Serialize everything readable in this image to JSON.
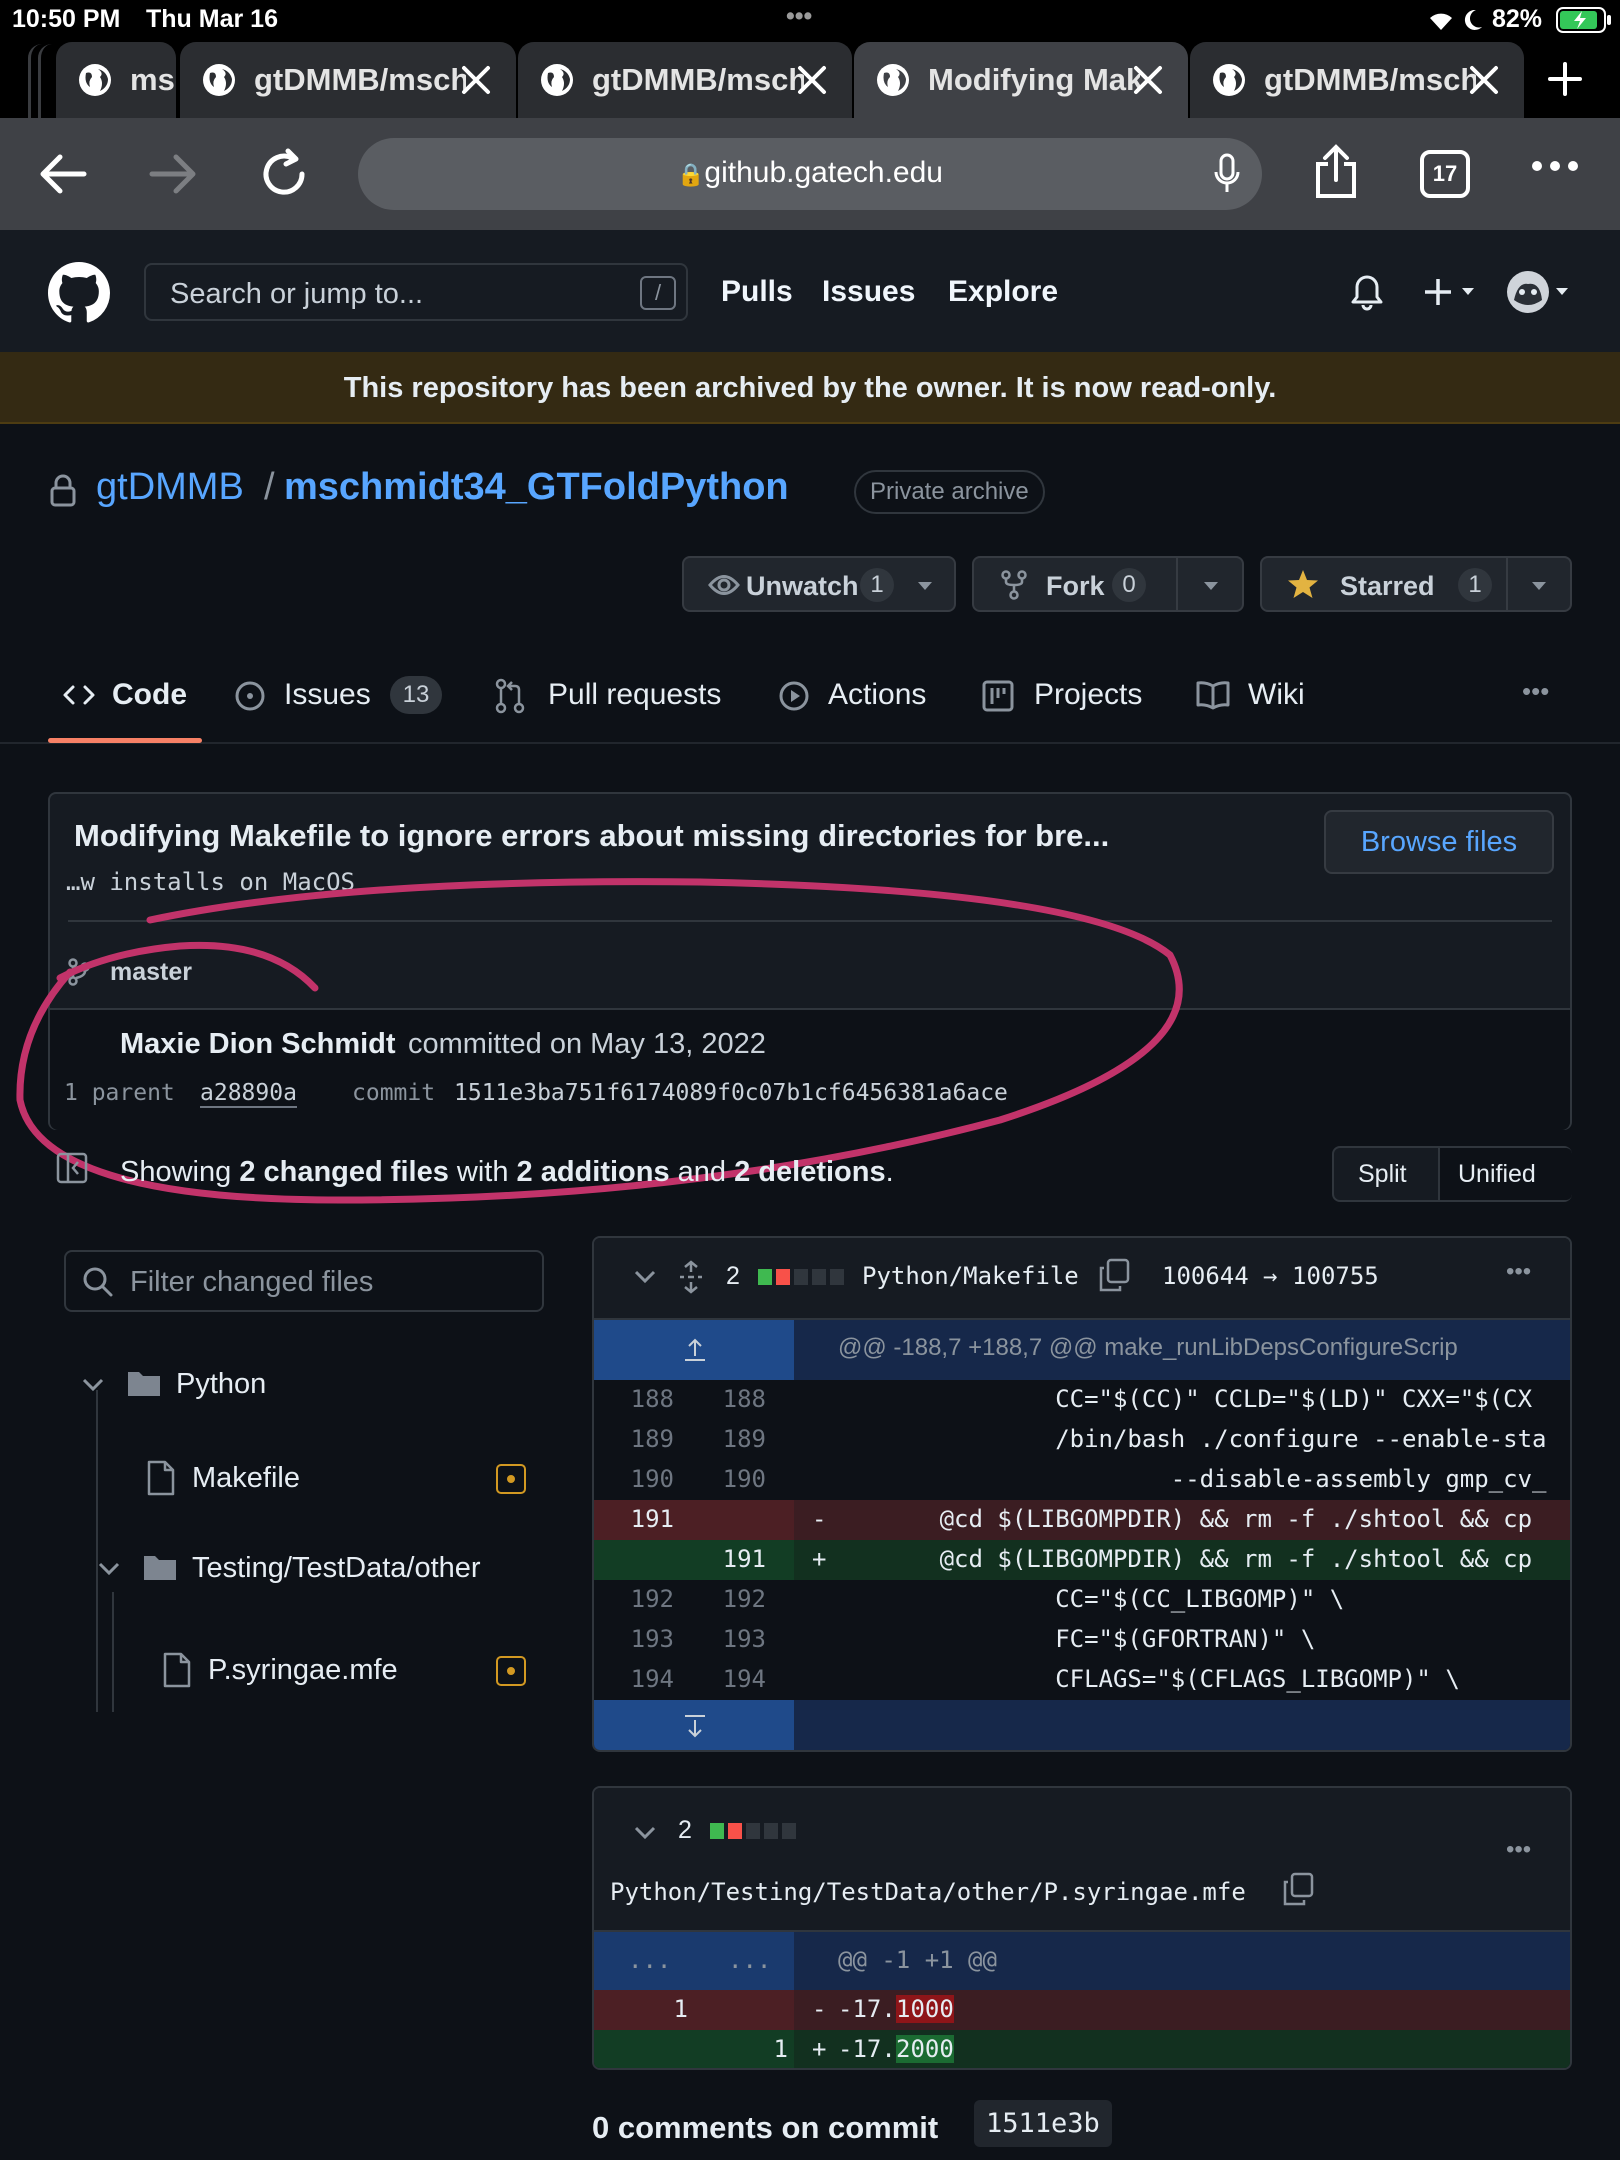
{
  "status_bar": {
    "time": "10:50 PM",
    "date": "Thu Mar 16",
    "dots": "•••",
    "battery": "82%"
  },
  "browser": {
    "tabs": [
      {
        "label": "msc"
      },
      {
        "label": "gtDMMB/msch"
      },
      {
        "label": "gtDMMB/msch"
      },
      {
        "label": "Modifying Mak"
      },
      {
        "label": "gtDMMB/msch"
      }
    ],
    "url": "github.gatech.edu",
    "tab_count": "17"
  },
  "github_header": {
    "search_placeholder": "Search or jump to...",
    "search_shortcut": "/",
    "nav": {
      "pulls": "Pulls",
      "issues": "Issues",
      "explore": "Explore"
    }
  },
  "archive_banner": "This repository has been archived by the owner. It is now read-only.",
  "repo": {
    "owner": "gtDMMB",
    "separator": "/",
    "name": "mschmidt34_GTFoldPython",
    "visibility": "Private archive",
    "unwatch_label": "Unwatch",
    "watch_count": "1",
    "fork_label": "Fork",
    "fork_count": "0",
    "starred_label": "Starred",
    "star_count": "1"
  },
  "repo_tabs": {
    "code": "Code",
    "issues": "Issues",
    "issues_count": "13",
    "pull_requests": "Pull requests",
    "actions": "Actions",
    "projects": "Projects",
    "wiki": "Wiki",
    "more": "•••"
  },
  "commit": {
    "title": "Modifying Makefile to ignore errors about missing directories for bre...",
    "title_cont": "…w installs on MacOS",
    "browse_files": "Browse files",
    "branch": "master",
    "author": "Maxie Dion Schmidt",
    "committed_text": "committed on May 13, 2022",
    "parent_label": "1 parent",
    "parent_sha": "a28890a",
    "commit_label": "commit",
    "commit_sha": "1511e3ba751f6174089f0c07b1cf6456381a6ace"
  },
  "summary": {
    "showing": "Showing",
    "files": "2 changed files",
    "with": "with",
    "additions": "2 additions",
    "and": "and",
    "deletions": "2 deletions",
    "period": ".",
    "split": "Split",
    "unified": "Unified"
  },
  "file_tree": {
    "filter_placeholder": "Filter changed files",
    "items": [
      {
        "label": "Python"
      },
      {
        "label": "Makefile"
      },
      {
        "label": "Testing/TestData/other"
      },
      {
        "label": "P.syringae.mfe"
      }
    ]
  },
  "diff1": {
    "changes": "2",
    "path": "Python/Makefile",
    "mode_change": "100644 → 100755",
    "more": "•••",
    "hunk_header": "@@ -188,7 +188,7 @@ make_runLibDepsConfigureScrip",
    "lines": [
      {
        "old": "188",
        "new": "188",
        "sign": "",
        "code": "                CC=\"$(CC)\" CCLD=\"$(LD)\" CXX=\"$(CX"
      },
      {
        "old": "189",
        "new": "189",
        "sign": "",
        "code": "                /bin/bash ./configure --enable-sta"
      },
      {
        "old": "190",
        "new": "190",
        "sign": "",
        "code": "                        --disable-assembly gmp_cv_"
      },
      {
        "old": "191",
        "new": "",
        "sign": "-",
        "code": "        @cd $(LIBGOMPDIR) && rm -f ./shtool && cp"
      },
      {
        "old": "",
        "new": "191",
        "sign": "+",
        "code": "        @cd $(LIBGOMPDIR) && rm -f ./shtool && cp"
      },
      {
        "old": "192",
        "new": "192",
        "sign": "",
        "code": "                CC=\"$(CC_LIBGOMP)\" \\"
      },
      {
        "old": "193",
        "new": "193",
        "sign": "",
        "code": "                FC=\"$(GFORTRAN)\" \\"
      },
      {
        "old": "194",
        "new": "194",
        "sign": "",
        "code": "                CFLAGS=\"$(CFLAGS_LIBGOMP)\" \\"
      }
    ]
  },
  "diff2": {
    "changes": "2",
    "path": "Python/Testing/TestData/other/P.syringae.mfe",
    "more": "•••",
    "hunk_old": "...",
    "hunk_new": "...",
    "hunk_header": "@@ -1 +1 @@",
    "del": {
      "old": "1",
      "sign": "-",
      "prefix": "-17.",
      "changed": "1000"
    },
    "add": {
      "new": "1",
      "sign": "+",
      "prefix": "-17.",
      "changed": "2000"
    }
  },
  "comments": {
    "label": "0 comments on commit",
    "sha": "1511e3b"
  },
  "colors": {
    "link": "#58a6ff",
    "annotation": "#c2336a",
    "deleted_bg": "#3b1d22",
    "added_bg": "#12301f",
    "hunk_bg": "#16284a"
  }
}
